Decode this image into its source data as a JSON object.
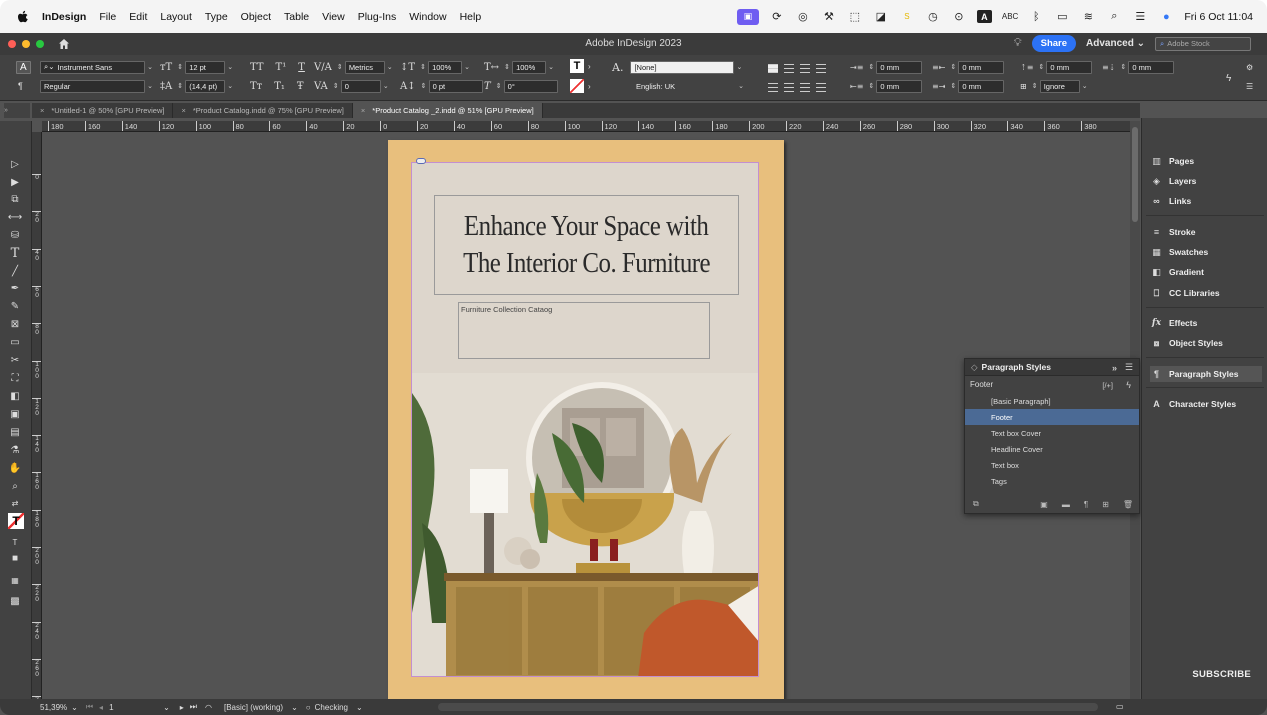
{
  "menubar": {
    "app_name": "InDesign",
    "items": [
      "File",
      "Edit",
      "Layout",
      "Type",
      "Object",
      "Table",
      "View",
      "Plug-Ins",
      "Window",
      "Help"
    ],
    "status": {
      "abc": "ABC",
      "clock": "Fri 6 Oct 11:04",
      "s_badge": "S"
    }
  },
  "window": {
    "title": "Adobe InDesign 2023",
    "share_label": "Share",
    "workspace": "Advanced",
    "stock_placeholder": "Adobe Stock"
  },
  "control": {
    "font_family": "Instrument Sans",
    "font_style": "Regular",
    "font_size": "12 pt",
    "leading": "(14,4 pt)",
    "kerning": "Metrics",
    "tracking": "0",
    "vscale": "100%",
    "hscale": "100%",
    "baseline": "0 pt",
    "skew": "0°",
    "char_style": "[None]",
    "language": "English: UK",
    "indent_left": "0 mm",
    "indent_right": "0 mm",
    "space_before": "0 mm",
    "space_after": "0 mm",
    "first_line": "0 mm",
    "last_line": "0 mm",
    "grid_align": "Ignore",
    "labels": {
      "tt_caps": "TT",
      "t_super": "T¹",
      "t_underline": "T",
      "tr_smallcaps": "Tт",
      "t_sub": "T₁",
      "t_strike": "Ŧ",
      "char_a": "A.",
      "tool_a": "A",
      "pilcrow": "¶",
      "chevron": "»"
    }
  },
  "tabs": [
    {
      "label": "*Untitled-1 @ 50% [GPU Preview]"
    },
    {
      "label": "*Product Catalog.indd @ 75% [GPU Preview]"
    },
    {
      "label": "*Product Catalog _2.indd @ 51% [GPU Preview]"
    }
  ],
  "rulers": {
    "h": [
      "180",
      "160",
      "140",
      "120",
      "100",
      "80",
      "60",
      "40",
      "20",
      "0",
      "20",
      "40",
      "60",
      "80",
      "100",
      "120",
      "140",
      "160",
      "180",
      "200",
      "220",
      "240",
      "260",
      "280",
      "300",
      "320",
      "340",
      "360",
      "380"
    ],
    "v": [
      "0",
      "20",
      "40",
      "60",
      "80",
      "100",
      "120",
      "140",
      "160",
      "180",
      "200",
      "220",
      "240",
      "260",
      "280"
    ]
  },
  "document": {
    "headline_1": "Enhance Your Space with",
    "headline_2": "The Interior Co. Furniture",
    "subtitle": "Furniture Collection Cataog"
  },
  "dock": {
    "items": [
      "Pages",
      "Layers",
      "Links",
      "Stroke",
      "Swatches",
      "Gradient",
      "CC Libraries",
      "Effects",
      "Object Styles",
      "Paragraph Styles",
      "Character Styles"
    ],
    "subscribe": "SUBSCRIBE"
  },
  "paragraph_styles": {
    "title": "Paragraph Styles",
    "current": "Footer",
    "items": [
      "[Basic Paragraph]",
      "Footer",
      "Text box Cover",
      "Headline Cover",
      "Text box",
      "Tags"
    ],
    "selected_index": 1,
    "head_icons": "»",
    "slashed_p": "[/+]"
  },
  "statusbar": {
    "zoom": "51,39%",
    "page": "1",
    "profile": "[Basic] (working)",
    "preflight": "Checking"
  },
  "colors": {
    "page_bg": "#e8bf7d",
    "accent_blue": "#2c72f5",
    "selected_row": "#4b6a95",
    "cc_icon": "#6f5df1"
  }
}
